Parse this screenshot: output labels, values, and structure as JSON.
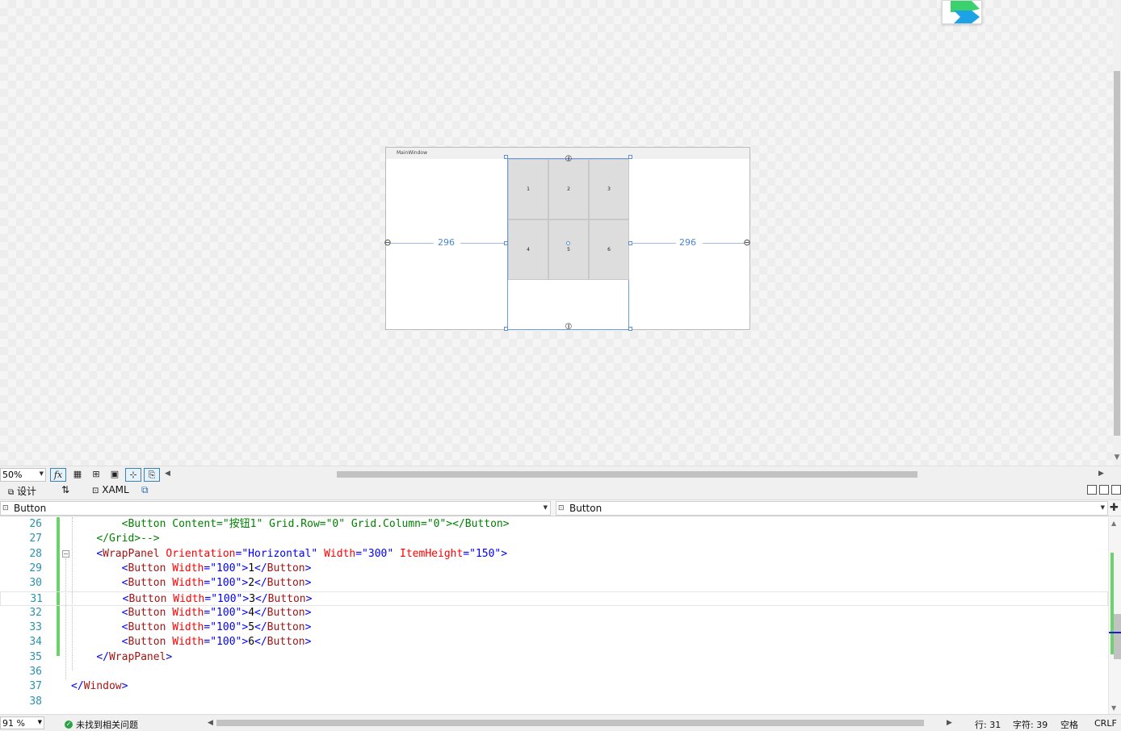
{
  "designer": {
    "window_title": "MainWindow",
    "buttons": [
      "1",
      "2",
      "3",
      "4",
      "5",
      "6"
    ],
    "margin_left": "296",
    "margin_right": "296"
  },
  "designer_toolbar": {
    "zoom": "50%",
    "fx_label": "fx"
  },
  "tabs": {
    "design": "设计",
    "swap": "⇅",
    "xaml": "XAML"
  },
  "dropdowns": {
    "left": "Button",
    "right": "Button"
  },
  "code": {
    "lines": [
      {
        "no": "26",
        "indent": "        ",
        "parts": [
          [
            "c-comment",
            "<Button Content=\"按钮1\" Grid.Row=\"0\" Grid.Column=\"0\"></Button>"
          ]
        ]
      },
      {
        "no": "27",
        "indent": "    ",
        "parts": [
          [
            "c-comment",
            "</Grid>-->"
          ]
        ]
      },
      {
        "no": "28",
        "indent": "    ",
        "parts": [
          [
            "c-blue",
            "<"
          ],
          [
            "c-tag",
            "WrapPanel"
          ],
          [
            "c-attr",
            " Orientation"
          ],
          [
            "c-blue",
            "=\"Horizontal\""
          ],
          [
            "c-attr",
            " Width"
          ],
          [
            "c-blue",
            "=\"300\""
          ],
          [
            "c-attr",
            " ItemHeight"
          ],
          [
            "c-blue",
            "=\"150\">"
          ]
        ]
      },
      {
        "no": "29",
        "indent": "        ",
        "parts": [
          [
            "c-blue",
            "<"
          ],
          [
            "c-tag",
            "Button"
          ],
          [
            "c-attr",
            " Width"
          ],
          [
            "c-blue",
            "=\"100\">"
          ],
          [
            "c-text",
            "1"
          ],
          [
            "c-blue",
            "</"
          ],
          [
            "c-tag",
            "Button"
          ],
          [
            "c-blue",
            ">"
          ]
        ]
      },
      {
        "no": "30",
        "indent": "        ",
        "parts": [
          [
            "c-blue",
            "<"
          ],
          [
            "c-tag",
            "Button"
          ],
          [
            "c-attr",
            " Width"
          ],
          [
            "c-blue",
            "=\"100\">"
          ],
          [
            "c-text",
            "2"
          ],
          [
            "c-blue",
            "</"
          ],
          [
            "c-tag",
            "Button"
          ],
          [
            "c-blue",
            ">"
          ]
        ]
      },
      {
        "no": "31",
        "indent": "        ",
        "parts": [
          [
            "c-blue",
            "<"
          ],
          [
            "c-tag",
            "Button"
          ],
          [
            "c-attr",
            " Width"
          ],
          [
            "c-blue",
            "=\"100\">"
          ],
          [
            "c-text",
            "3"
          ],
          [
            "c-blue",
            "</"
          ],
          [
            "c-tag",
            "Button"
          ],
          [
            "c-blue",
            ">"
          ]
        ]
      },
      {
        "no": "32",
        "indent": "        ",
        "parts": [
          [
            "c-blue",
            "<"
          ],
          [
            "c-tag",
            "Button"
          ],
          [
            "c-attr",
            " Width"
          ],
          [
            "c-blue",
            "=\"100\">"
          ],
          [
            "c-text",
            "4"
          ],
          [
            "c-blue",
            "</"
          ],
          [
            "c-tag",
            "Button"
          ],
          [
            "c-blue",
            ">"
          ]
        ]
      },
      {
        "no": "33",
        "indent": "        ",
        "parts": [
          [
            "c-blue",
            "<"
          ],
          [
            "c-tag",
            "Button"
          ],
          [
            "c-attr",
            " Width"
          ],
          [
            "c-blue",
            "=\"100\">"
          ],
          [
            "c-text",
            "5"
          ],
          [
            "c-blue",
            "</"
          ],
          [
            "c-tag",
            "Button"
          ],
          [
            "c-blue",
            ">"
          ]
        ]
      },
      {
        "no": "34",
        "indent": "        ",
        "parts": [
          [
            "c-blue",
            "<"
          ],
          [
            "c-tag",
            "Button"
          ],
          [
            "c-attr",
            " Width"
          ],
          [
            "c-blue",
            "=\"100\">"
          ],
          [
            "c-text",
            "6"
          ],
          [
            "c-blue",
            "</"
          ],
          [
            "c-tag",
            "Button"
          ],
          [
            "c-blue",
            ">"
          ]
        ]
      },
      {
        "no": "35",
        "indent": "    ",
        "parts": [
          [
            "c-blue",
            "</"
          ],
          [
            "c-tag",
            "WrapPanel"
          ],
          [
            "c-blue",
            ">"
          ]
        ]
      },
      {
        "no": "36",
        "indent": "",
        "parts": []
      },
      {
        "no": "37",
        "indent": "",
        "parts": [
          [
            "c-blue",
            "</"
          ],
          [
            "c-tag",
            "Window"
          ],
          [
            "c-blue",
            ">"
          ]
        ]
      },
      {
        "no": "38",
        "indent": "",
        "parts": []
      }
    ],
    "current_line": "31"
  },
  "status": {
    "zoom": "91 %",
    "issues": "未找到相关问题",
    "line": "行: 31",
    "char": "字符: 39",
    "whitespace": "空格",
    "eol": "CRLF"
  },
  "colors": {
    "accent": "#4a86d0",
    "change_bar": "#6ad46a",
    "ok": "#2ea043"
  }
}
